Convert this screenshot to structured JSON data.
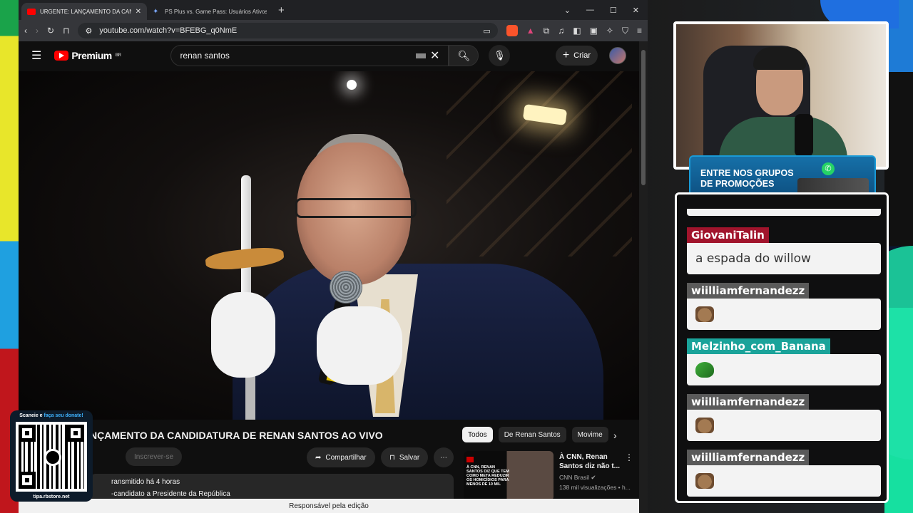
{
  "browser": {
    "tabs": [
      {
        "title": "URGENTE: LANÇAMENTO DA CAND",
        "active": true
      },
      {
        "title": "PS Plus vs. Game Pass: Usuários Ativos - Goo",
        "active": false
      }
    ],
    "url": "youtube.com/watch?v=BFEBG_q0NmE"
  },
  "youtube": {
    "logo": "Premium",
    "logo_region": "BR",
    "search_query": "renan santos",
    "create_label": "Criar",
    "video_title": "NÇAMENTO DA CANDIDATURA DE RENAN SANTOS AO VIVO",
    "subscribe_label": "Inscrever-se",
    "share_label": "Compartilhar",
    "save_label": "Salvar",
    "description_line1": "ransmitido há 4 horas",
    "description_line2": "-candidato a Presidente da República",
    "chips": [
      "Todos",
      "De Renan Santos",
      "Movime"
    ],
    "recommended": {
      "title": "À CNN, Renan Santos diz não t...",
      "channel": "CNN Brasil",
      "views": "138 mil visualizações • h...",
      "thumb_text": "À CNN, RENAN SANTOS DIZ QUE TEM COMO META REDUZIR OS HOMICÍDIOS PARA MENOS DE 10 MIL"
    },
    "caption": "Responsável pela edição"
  },
  "stream": {
    "promo_line1": "ENTRE NOS GRUPOS",
    "promo_line2": "DE PROMOÇÕES",
    "chat": [
      {
        "user": "GiovaniTalin",
        "color": "#a1142c",
        "message": "a espada do willow",
        "emote": ""
      },
      {
        "user": "wiilliamfernandezz",
        "color": "#5a5a5a",
        "message": "",
        "emote": "bear"
      },
      {
        "user": "Melzinho_com_Banana",
        "color": "#1aa39a",
        "message": "",
        "emote": "frog"
      },
      {
        "user": "wiilliamfernandezz",
        "color": "#5a5a5a",
        "message": "",
        "emote": "bear"
      },
      {
        "user": "wiilliamfernandezz",
        "color": "#5a5a5a",
        "message": "",
        "emote": "bear"
      }
    ],
    "qr_top_a": "Scaneie e ",
    "qr_top_b": "faça seu donate!",
    "qr_bottom": "tipa.rbstore.net"
  },
  "icons": {
    "close": "×",
    "search": "search-icon",
    "mic": "mic-icon"
  }
}
